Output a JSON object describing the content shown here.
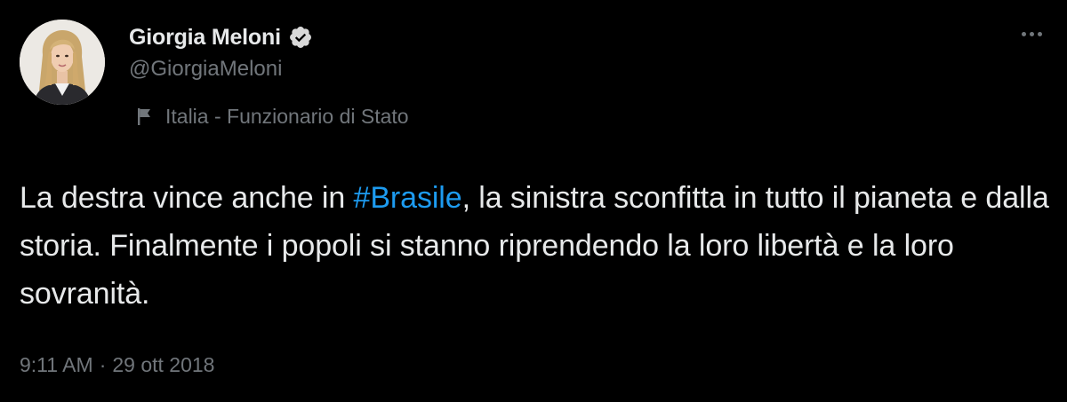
{
  "author": {
    "display_name": "Giorgia Meloni",
    "handle": "@GiorgiaMeloni",
    "verified": true,
    "label": "Italia - Funzionario di Stato"
  },
  "tweet": {
    "text_before": "La destra vince anche in ",
    "hashtag": "#Brasile",
    "text_after": ", la sinistra sconfitta in tutto il pianeta e dalla storia. Finalmente i popoli si stanno riprendendo la loro libertà e la loro sovranità.",
    "time": "9:11 AM",
    "separator": "·",
    "date": "29 ott 2018"
  },
  "icons": {
    "verified": "verified-badge-icon",
    "more": "more-horizontal-icon",
    "label": "flag-icon"
  },
  "colors": {
    "background": "#000000",
    "text": "#e7e9ea",
    "secondary": "#71767b",
    "accent": "#1d9bf0"
  }
}
